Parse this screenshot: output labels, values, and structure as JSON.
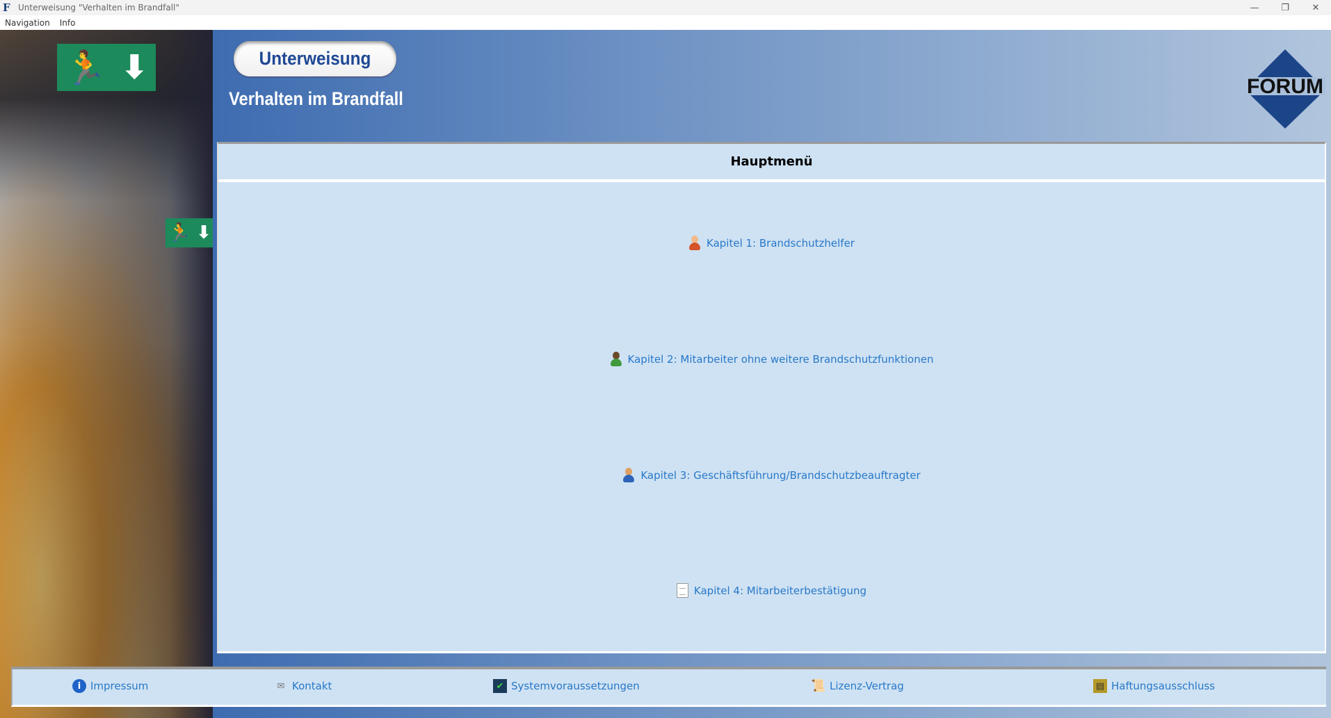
{
  "window": {
    "title": "Unterweisung \"Verhalten im Brandfall\"",
    "controls": [
      "minimize",
      "restore",
      "close"
    ]
  },
  "menu": [
    "Navigation",
    "Info"
  ],
  "header": {
    "badge": "Unterweisung",
    "title": "Verhalten im Brandfall",
    "logo_text": "FORUM"
  },
  "main": {
    "heading": "Hauptmenü",
    "chapters": [
      {
        "label": "Kapitel 1: Brandschutzhelfer",
        "icon": "user-orange-icon",
        "color": "#d4542a"
      },
      {
        "label": "Kapitel 2: Mitarbeiter ohne weitere Brandschutzfunktionen",
        "icon": "user-green-icon",
        "color": "#3f9a3c"
      },
      {
        "label": "Kapitel 3: Geschäftsführung/Brandschutzbeauftragter",
        "icon": "user-blue-icon",
        "color": "#2e64b8"
      },
      {
        "label": "Kapitel 4: Mitarbeiterbestätigung",
        "icon": "document-icon"
      }
    ]
  },
  "footer": [
    {
      "label": "Impressum",
      "icon": "info-icon"
    },
    {
      "label": "Kontakt",
      "icon": "contact-icon"
    },
    {
      "label": "Systemvoraussetzungen",
      "icon": "system-check-icon"
    },
    {
      "label": "Lizenz-Vertrag",
      "icon": "contract-scroll-icon"
    },
    {
      "label": "Haftungsausschluss",
      "icon": "book-icon"
    }
  ],
  "colors": {
    "link": "#2878c8",
    "panel": "#cfe2f3",
    "header_start": "#3e6cb0",
    "header_end": "#b1c5dd",
    "exit_green": "#1d8a5b"
  }
}
